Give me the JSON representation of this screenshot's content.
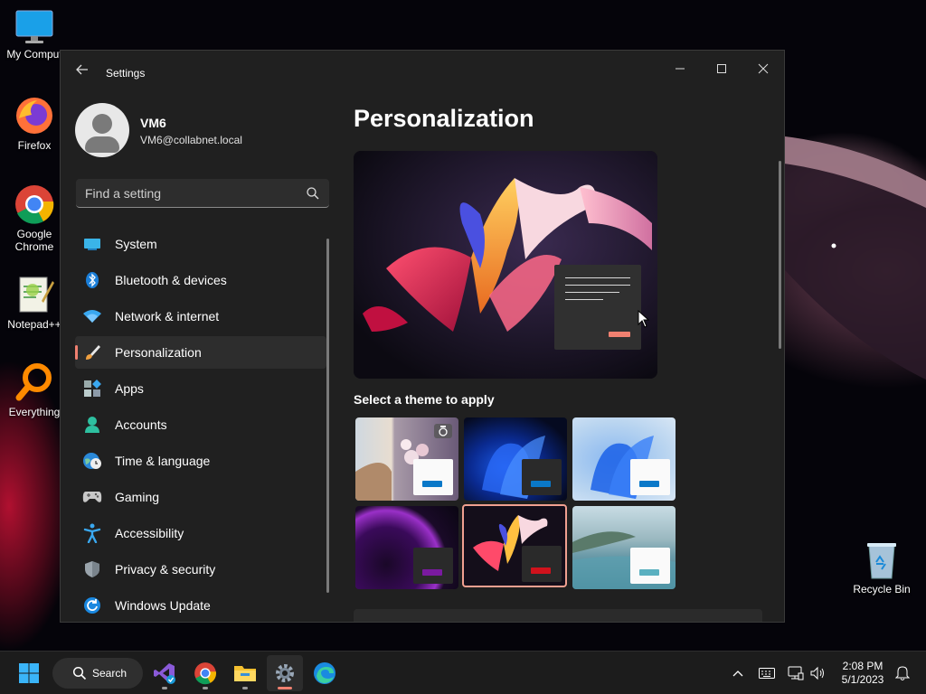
{
  "desktop": {
    "icons": [
      {
        "label": "My Comput"
      },
      {
        "label": "Firefox"
      },
      {
        "label": "Google\nChrome"
      },
      {
        "label": "Notepad++"
      },
      {
        "label": "Everything"
      },
      {
        "label": "Recycle Bin"
      }
    ]
  },
  "window": {
    "title": "Settings",
    "controls": {
      "minimize": "minimize-icon",
      "maximize": "maximize-icon",
      "close": "close-icon"
    }
  },
  "profile": {
    "name": "VM6",
    "email": "VM6@collabnet.local"
  },
  "search": {
    "placeholder": "Find a setting"
  },
  "nav": {
    "items": [
      {
        "label": "System",
        "icon": "system-icon"
      },
      {
        "label": "Bluetooth & devices",
        "icon": "bluetooth-icon"
      },
      {
        "label": "Network & internet",
        "icon": "wifi-icon"
      },
      {
        "label": "Personalization",
        "icon": "brush-icon",
        "active": true
      },
      {
        "label": "Apps",
        "icon": "apps-icon"
      },
      {
        "label": "Accounts",
        "icon": "person-icon"
      },
      {
        "label": "Time & language",
        "icon": "globe-clock-icon"
      },
      {
        "label": "Gaming",
        "icon": "gamepad-icon"
      },
      {
        "label": "Accessibility",
        "icon": "accessibility-icon"
      },
      {
        "label": "Privacy & security",
        "icon": "shield-icon"
      },
      {
        "label": "Windows Update",
        "icon": "update-icon"
      }
    ]
  },
  "main": {
    "title": "Personalization",
    "theme_section_label": "Select a theme to apply",
    "themes": [
      {
        "name": "spotlight",
        "accent": "#0a78c8"
      },
      {
        "name": "windows-dark",
        "accent": "#0a78c8"
      },
      {
        "name": "windows-light",
        "accent": "#0a78c8"
      },
      {
        "name": "glow",
        "accent": "#7a1aa0"
      },
      {
        "name": "captured-motion",
        "accent": "#d0121c",
        "selected": true
      },
      {
        "name": "flow",
        "accent": "#5ab0c0"
      }
    ]
  },
  "taskbar": {
    "search_label": "Search",
    "time": "2:08 PM",
    "date": "5/1/2023"
  },
  "colors": {
    "accent": "#f08070",
    "window_bg": "#202020",
    "taskbar_bg": "#1c1c1c"
  }
}
